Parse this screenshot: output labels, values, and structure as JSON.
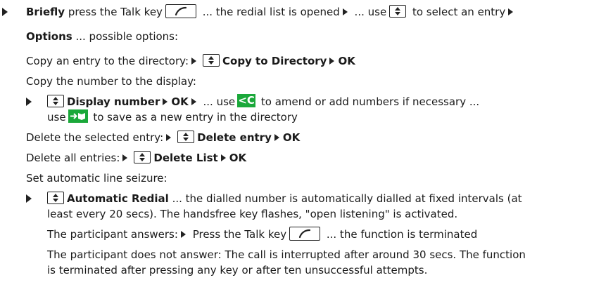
{
  "colors": {
    "accent_green": "#1aa83a",
    "text": "#1a1a1a"
  },
  "l1": {
    "a": "Briefly",
    "b": " press the Talk key",
    "c": " ... the redial list is opened",
    "d": " ... use",
    "e": " to select an entry"
  },
  "l2": {
    "a": "Options",
    "b": " ... possible options:"
  },
  "l3": {
    "a": "Copy an entry to the directory:",
    "b": "Copy to Directory",
    "c": "OK"
  },
  "l4": {
    "a": "Copy the number to the display:"
  },
  "l5": {
    "a": "Display number",
    "b": "OK",
    "c": " ... use",
    "d": " to amend or add numbers if necessary ..."
  },
  "l6": {
    "a": "use",
    "b": " to save as a new entry in the directory"
  },
  "l7": {
    "a": "Delete the selected entry:",
    "b": "Delete entry",
    "c": "OK"
  },
  "l8": {
    "a": "Delete all entries:",
    "b": "Delete List",
    "c": "OK"
  },
  "l9": {
    "a": "Set automatic line seizure:"
  },
  "l10": {
    "a": "Automatic Redial",
    "b": " ... the dialled number is automatically dialled at fixed intervals (at"
  },
  "l11": {
    "a": "least every 20 secs). The handsfree key flashes, \"open listening\" is activated."
  },
  "l12": {
    "a": "The participant answers:",
    "b": " Press the Talk key",
    "c": " ...  the function is terminated"
  },
  "l13": {
    "a": "The participant does not answer: The call is interrupted after around 30 secs. The function"
  },
  "l14": {
    "a": "is terminated after pressing any key or after ten unsuccessful attempts."
  },
  "keys": {
    "c_key": "C",
    "c_key_arrow": "<"
  }
}
